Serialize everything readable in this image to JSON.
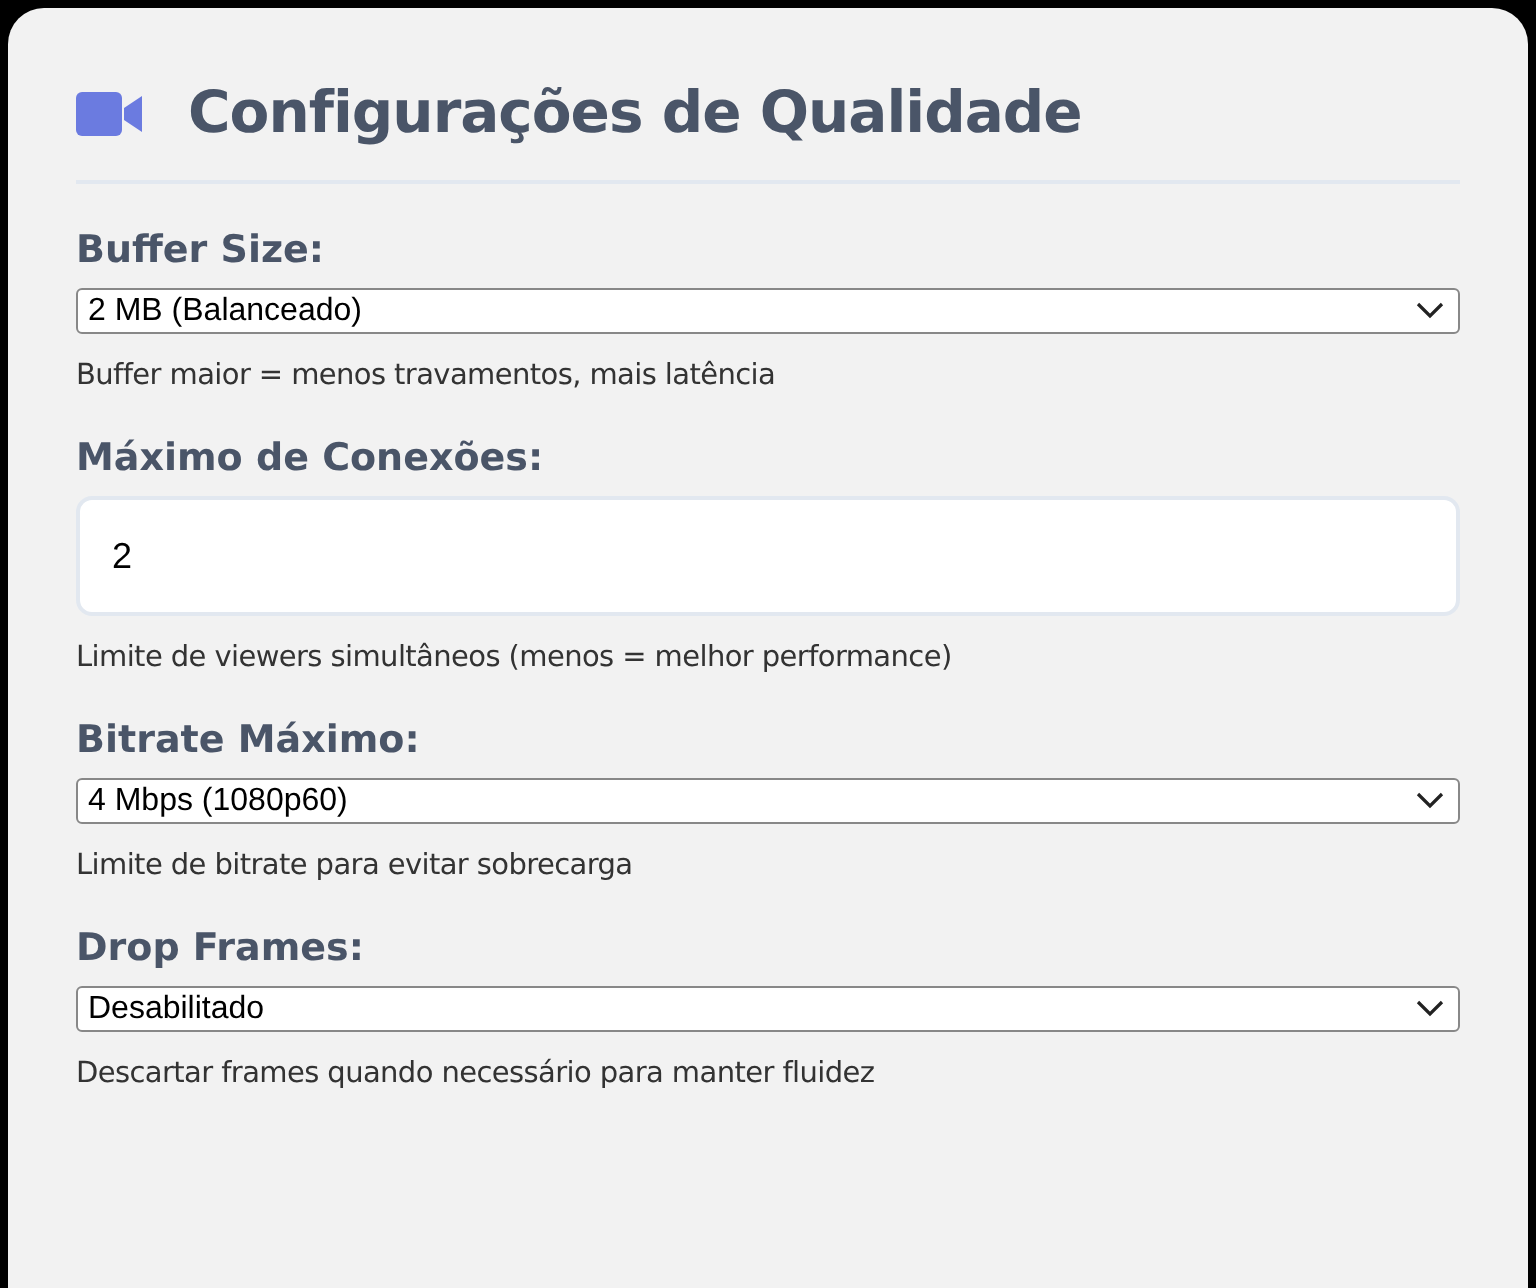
{
  "title": "Configurações de Qualidade",
  "fields": [
    {
      "kind": "select",
      "label": "Buffer Size:",
      "value": "2 MB (Balanceado)",
      "hint": "Buffer maior = menos travamentos, mais latência"
    },
    {
      "kind": "input",
      "label": "Máximo de Conexões:",
      "value": "2",
      "hint": "Limite de viewers simultâneos (menos = melhor performance)"
    },
    {
      "kind": "select",
      "label": "Bitrate Máximo:",
      "value": "4 Mbps (1080p60)",
      "hint": "Limite de bitrate para evitar sobrecarga"
    },
    {
      "kind": "select",
      "label": "Drop Frames:",
      "value": "Desabilitado",
      "hint": "Descartar frames quando necessário para manter fluidez"
    }
  ]
}
